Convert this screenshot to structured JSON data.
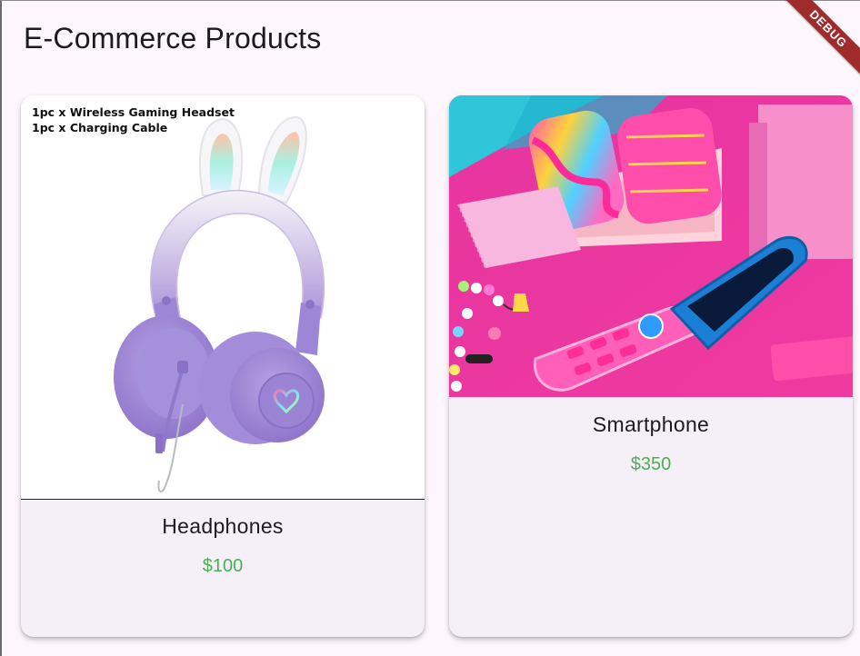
{
  "app": {
    "title": "E-Commerce Products",
    "banner": "DEBUG"
  },
  "products": [
    {
      "name": "Headphones",
      "price": "$100",
      "image_text": [
        "1pc x Wireless Gaming Headset",
        "1pc x Charging Cable"
      ]
    },
    {
      "name": "Smartphone",
      "price": "$350"
    }
  ],
  "colors": {
    "background": "#fdf6fd",
    "card": "#f5f0f8",
    "price": "#4caf50",
    "debug_banner": "#a02b2b"
  }
}
